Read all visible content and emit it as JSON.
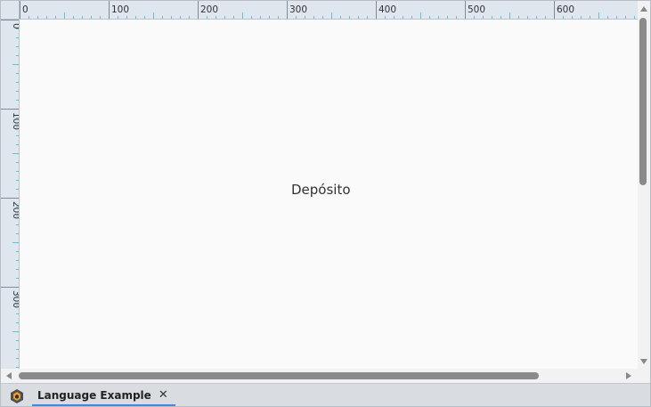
{
  "rulers": {
    "horizontal_labels": [
      "0",
      "100",
      "200",
      "300",
      "400",
      "500",
      "600"
    ],
    "vertical_labels": [
      "0",
      "100",
      "200",
      "300"
    ]
  },
  "canvas": {
    "label": "Depósito"
  },
  "tab": {
    "label": "Language Example",
    "close_glyph": "✕"
  },
  "icons": {
    "app": "ignition-app-icon",
    "close": "close-icon"
  },
  "colors": {
    "ruler_background": "#e0e6ee",
    "ruler_tick": "#5ec4d4",
    "tab_underline": "#3f8ae0",
    "scroll_thumb": "#8a8a8a"
  }
}
